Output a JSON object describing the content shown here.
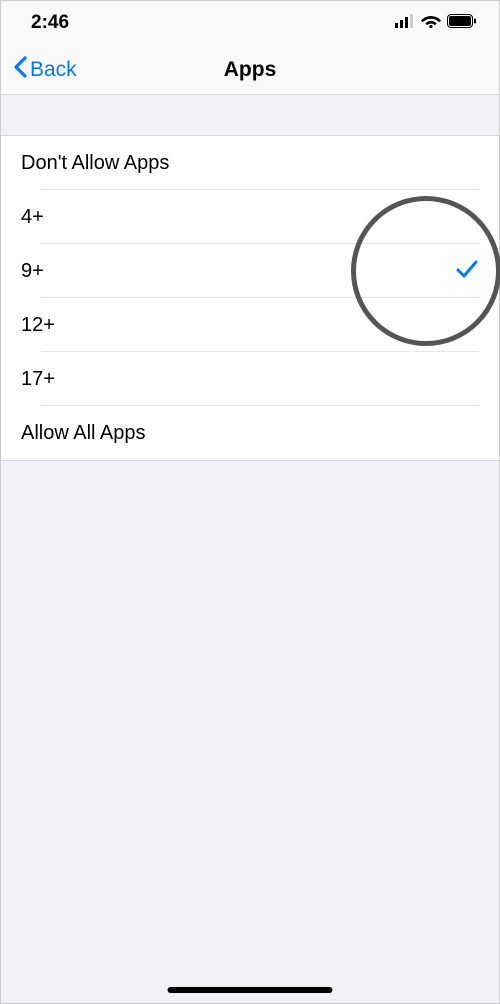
{
  "status": {
    "time": "2:46"
  },
  "nav": {
    "back_label": "Back",
    "title": "Apps"
  },
  "options": [
    {
      "label": "Don't Allow Apps",
      "selected": false
    },
    {
      "label": "4+",
      "selected": false
    },
    {
      "label": "9+",
      "selected": true
    },
    {
      "label": "12+",
      "selected": false
    },
    {
      "label": "17+",
      "selected": false
    },
    {
      "label": "Allow All Apps",
      "selected": false
    }
  ]
}
